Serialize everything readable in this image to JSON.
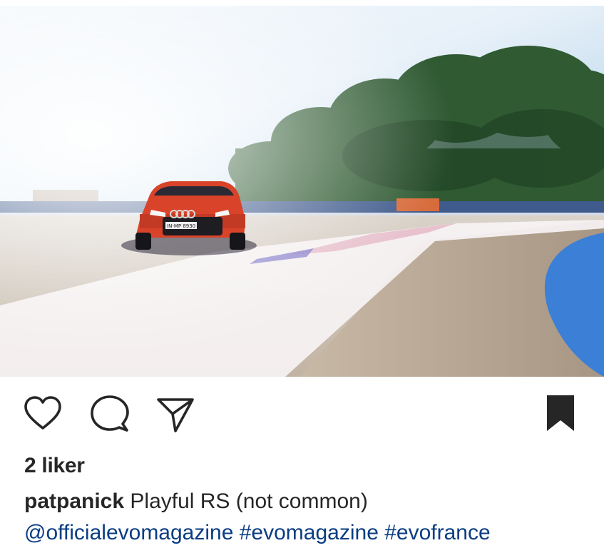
{
  "post": {
    "image_alt": "Red Audi RS hatchback drifting on a race track",
    "plate_text": "IN-MP 8930",
    "likes_text": "2 liker",
    "username": "patpanick",
    "caption_text": "Playful RS (not common)",
    "tags": [
      "@officialevomagazine",
      "#evomagazine",
      "#evofrance"
    ]
  },
  "icons": {
    "like": "heart-icon",
    "comment": "comment-icon",
    "share": "share-icon",
    "save": "bookmark-icon"
  },
  "colors": {
    "text": "#262626",
    "link": "#0a3d82",
    "car": "#d8432a"
  }
}
